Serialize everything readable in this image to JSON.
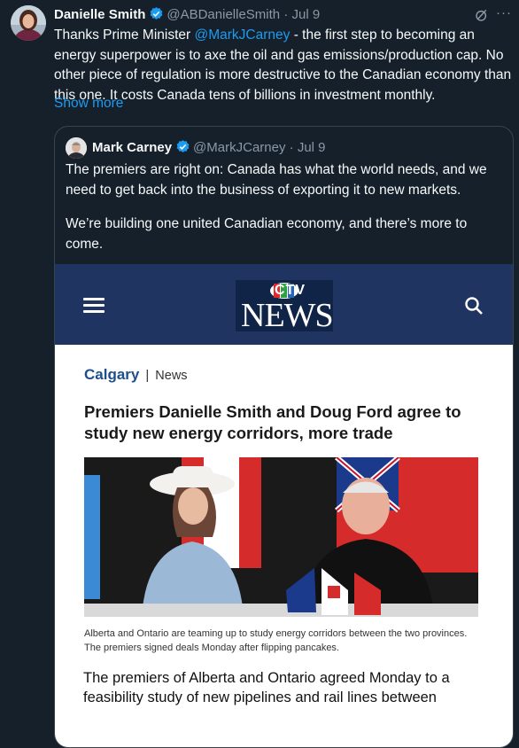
{
  "tweet": {
    "author_name": "Danielle Smith",
    "handle": "@ABDanielleSmith",
    "separator": "·",
    "date": "Jul 9",
    "text_before": "Thanks Prime Minister ",
    "mention": "@MarkJCarney",
    "text_after": " - the first step to becoming an energy superpower is to axe the oil and gas emissions/production cap. No other piece of regulation is more destructive to the Canadian economy than this one. It costs Canada tens of billions in investment monthly.",
    "show_more": "Show more",
    "more_icon": "···"
  },
  "quote": {
    "author_name": "Mark Carney",
    "handle": "@MarkJCarney",
    "separator": "·",
    "date": "Jul 9",
    "paragraph1": "The premiers are right on: Canada has what the world needs, and we need to get back into the business of exporting it to new markets.",
    "paragraph2": "We’re building one united Canadian economy, and there’s more to come."
  },
  "card": {
    "logo_ctv": "CTV",
    "logo_news": "NEWS",
    "city": "Calgary",
    "divider": "|",
    "section": "News",
    "headline": "Premiers Danielle Smith and Doug Ford agree to study new energy corridors, more trade",
    "caption": "Alberta and Ontario are teaming up to study energy corridors between the two provinces. The premiers signed deals Monday after flipping pancakes.",
    "lede": "The premiers of Alberta and Ontario agreed Monday to a feasibility study of new pipelines and rail lines between"
  },
  "colors": {
    "background": "#15202b",
    "accent": "#1d9bf0",
    "ctv_bar": "#1f3461",
    "verified": "#1d9bf0"
  }
}
